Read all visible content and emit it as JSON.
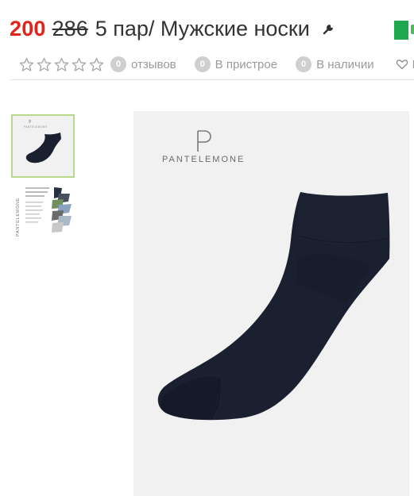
{
  "product": {
    "price_new": "200",
    "price_old": "286",
    "title": "5 пар/ Мужские носки"
  },
  "meta": {
    "rating_stars": 0,
    "reviews": {
      "count": "0",
      "label": "отзывов"
    },
    "in_store": {
      "count": "0",
      "label": "В пристрое"
    },
    "in_stock": {
      "count": "0",
      "label": "В наличии"
    },
    "favorite_label": "В"
  },
  "gallery": {
    "brand": "PANTELEMONE",
    "brand_letter": "P",
    "thumbnails": [
      {
        "name": "thumb-black-sock",
        "selected": true
      },
      {
        "name": "thumb-size-chart",
        "selected": false
      }
    ]
  },
  "colors": {
    "price": "#e2231a",
    "accent_green": "#1fa84f",
    "thumb_border": "#b8d98c",
    "badge": "#cfcfcf",
    "sock": "#1b2030"
  }
}
